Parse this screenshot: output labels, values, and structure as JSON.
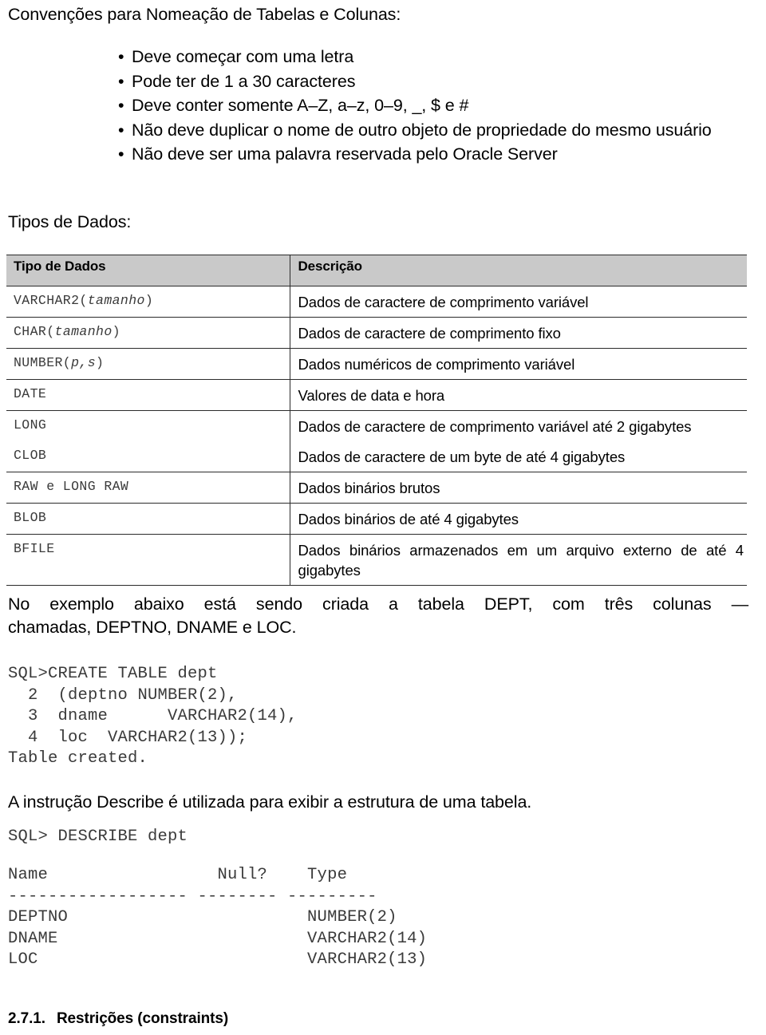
{
  "document": {
    "title": "Convenções para Nomeação de Tabelas e Colunas:",
    "naming_rules": [
      "Deve começar com uma letra",
      "Pode ter de 1 a 30 caracteres",
      "Deve conter somente A–Z, a–z, 0–9, _, $ e #",
      "Não deve duplicar o nome de outro objeto de propriedade do mesmo usuário",
      "Não deve ser uma palavra reservada pelo Oracle Server"
    ],
    "datatypes_heading": "Tipos de Dados:",
    "datatypes_table": {
      "headers": [
        "Tipo de Dados",
        "Descrição"
      ],
      "rows": [
        {
          "type_prefix": "VARCHAR2(",
          "type_italic": "tamanho",
          "type_suffix": ")",
          "description": "Dados de caractere de comprimento variável"
        },
        {
          "type_prefix": "CHAR(",
          "type_italic": "tamanho",
          "type_suffix": ")",
          "description": "Dados de caractere de comprimento fixo"
        },
        {
          "type_prefix": "NUMBER(",
          "type_italic": "p,s",
          "type_suffix": ")",
          "description": "Dados numéricos de comprimento variável"
        },
        {
          "type_prefix": "DATE",
          "type_italic": "",
          "type_suffix": "",
          "description": "Valores de data e hora"
        },
        {
          "type_prefix": "LONG",
          "type_italic": "",
          "type_suffix": "",
          "description": "Dados de caractere de comprimento variável até 2 gigabytes"
        },
        {
          "type_prefix": "CLOB",
          "type_italic": "",
          "type_suffix": "",
          "description": "Dados de caractere de um byte de até 4 gigabytes"
        },
        {
          "type_prefix": "RAW e LONG RAW",
          "type_italic": "",
          "type_suffix": "",
          "description": "Dados binários brutos"
        },
        {
          "type_prefix": "BLOB",
          "type_italic": "",
          "type_suffix": "",
          "description": "Dados binários de até 4 gigabytes"
        },
        {
          "type_prefix": "BFILE",
          "type_italic": "",
          "type_suffix": "",
          "description": "Dados binários armazenados em um arquivo externo de até 4 gigabytes"
        }
      ]
    },
    "example_intro_line1": "No exemplo abaixo está sendo criada  a tabela DEPT, com três colunas —",
    "example_intro_line2": "chamadas, DEPTNO, DNAME e LOC.",
    "create_table_code": "SQL>CREATE TABLE dept\n  2  (deptno NUMBER(2),\n  3  dname      VARCHAR2(14),\n  4  loc  VARCHAR2(13));\nTable created.",
    "describe_intro": "A instrução Describe é utilizada para exibir a estrutura de uma tabela.",
    "describe_command": "SQL> DESCRIBE dept",
    "describe_output": "Name                 Null?    Type\n------------------ -------- ---------\nDEPTNO                        NUMBER(2)\nDNAME                         VARCHAR2(14)\nLOC                           VARCHAR2(13)",
    "section_number": "2.7.1.",
    "section_title": "Restrições (constraints)"
  },
  "colors": {
    "text": "#000000",
    "code_text": "#3a3a3a",
    "table_header_bg": "#c9c9c9",
    "table_border": "#2b2b2b",
    "page_bg": "#ffffff"
  }
}
